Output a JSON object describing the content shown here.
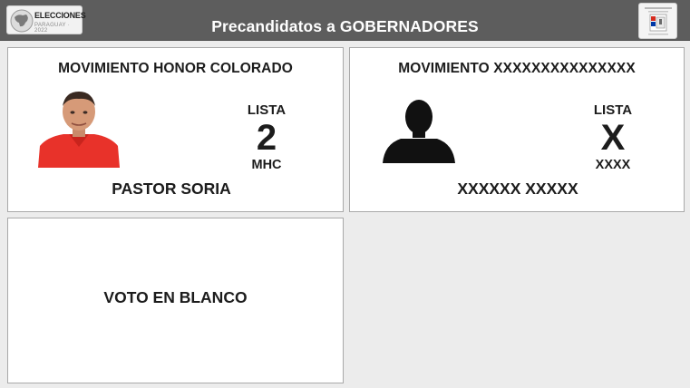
{
  "header": {
    "title": "Precandidatos a GOBERNADORES",
    "logo_left": {
      "icon": "paraguay-map-icon",
      "text": "ELECCIONES",
      "subtext": "PARAGUAY · 2022"
    },
    "logo_right": {
      "icon": "tsje-emblem-icon"
    },
    "background": "#5d5d5d"
  },
  "candidates": [
    {
      "movement": "MOVIMIENTO HONOR COLORADO",
      "list_label": "LISTA",
      "list_number": "2",
      "list_acronym": "MHC",
      "name": "PASTOR SORIA",
      "photo": "candidate-photo"
    },
    {
      "movement": "MOVIMIENTO XXXXXXXXXXXXXXX",
      "list_label": "LISTA",
      "list_number": "X",
      "list_acronym": "XXXX",
      "name": "XXXXXX XXXXX",
      "photo": "silhouette-icon"
    }
  ],
  "blank_vote": {
    "label": "VOTO EN BLANCO"
  }
}
